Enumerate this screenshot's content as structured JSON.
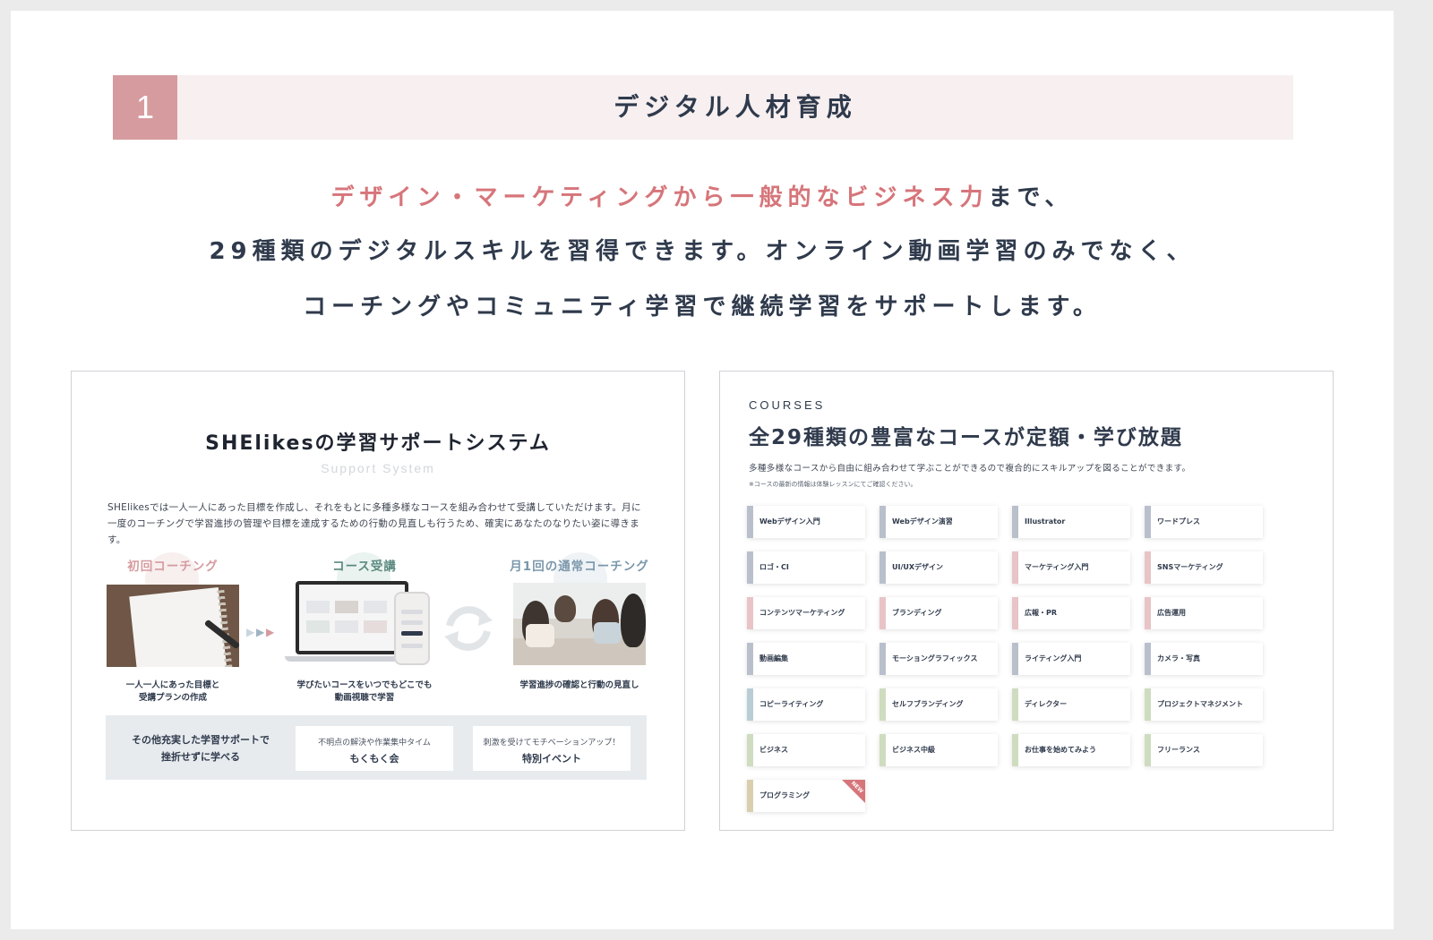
{
  "header": {
    "number": "1",
    "title": "デジタル人材育成"
  },
  "intro": {
    "line1_highlight": "デザイン・マーケティングから一般的なビジネス力",
    "line1_rest": "まで、",
    "line2": "29種類のデジタルスキルを習得できます。オンライン動画学習のみでなく、",
    "line3": "コーチングやコミュニティ学習で継続学習をサポートします。"
  },
  "support": {
    "title": "SHElikesの学習サポートシステム",
    "subtitle": "Support System",
    "description_1": "SHElikesでは一人一人にあった目標を作成し、それをもとに多種多様なコースを組み合わせて受講していただけます。月に",
    "description_2": "一度のコーチングで学習進捗の管理や目標を達成するための行動の見直しも行うため、確実にあなたのなりたい姿に導きます。",
    "steps": [
      {
        "label": "初回コーチング",
        "caption_1": "一人一人にあった目標と",
        "caption_2": "受講プランの作成",
        "color": "#d69b9f"
      },
      {
        "label": "コース受講",
        "caption_1": "学びたいコースをいつでもどこでも",
        "caption_2": "動画視聴で学習",
        "color": "#5a8a7e"
      },
      {
        "label": "月1回の通常コーチング",
        "caption_1": "学習進捗の確認と行動の見直し",
        "caption_2": "",
        "color": "#7a97ab"
      }
    ],
    "bottom": {
      "text_1": "その他充実した学習サポートで",
      "text_2": "挫折せずに学べる",
      "cards": [
        {
          "sub": "不明点の解決や作業集中タイム",
          "title": "もくもく会"
        },
        {
          "sub": "刺激を受けてモチベーションアップ！",
          "title": "特別イベント"
        }
      ]
    }
  },
  "courses": {
    "eyebrow": "COURSES",
    "title": "全29種類の豊富なコースが定額・学び放題",
    "description": "多種多様なコースから自由に組み合わせて学ぶことができるので複合的にスキルアップを図ることができます。",
    "note": "※コースの最新の情報は体験レッスンにてご確認ください。",
    "new_badge": "NEW",
    "items": [
      {
        "label": "Webデザイン入門",
        "color": "#b9c0cc"
      },
      {
        "label": "Webデザイン演習",
        "color": "#b9c0cc"
      },
      {
        "label": "Illustrator",
        "color": "#b9c0cc"
      },
      {
        "label": "ワードプレス",
        "color": "#b9c0cc"
      },
      {
        "label": "ロゴ・CI",
        "color": "#b9c0cc"
      },
      {
        "label": "UI/UXデザイン",
        "color": "#b9c0cc"
      },
      {
        "label": "マーケティング入門",
        "color": "#e8c4c6"
      },
      {
        "label": "SNSマーケティング",
        "color": "#e8c4c6"
      },
      {
        "label": "コンテンツマーケティング",
        "color": "#e8c4c6"
      },
      {
        "label": "ブランディング",
        "color": "#e8c4c6"
      },
      {
        "label": "広報・PR",
        "color": "#e8c4c6"
      },
      {
        "label": "広告運用",
        "color": "#e8c4c6"
      },
      {
        "label": "動画編集",
        "color": "#b9c0cc"
      },
      {
        "label": "モーショングラフィックス",
        "color": "#b9c0cc"
      },
      {
        "label": "ライティング入門",
        "color": "#b9c0cc"
      },
      {
        "label": "カメラ・写真",
        "color": "#b9c0cc"
      },
      {
        "label": "コピーライティング",
        "color": "#b9cdd4"
      },
      {
        "label": "セルフブランディング",
        "color": "#cfdcc0"
      },
      {
        "label": "ディレクター",
        "color": "#cfdcc0"
      },
      {
        "label": "プロジェクトマネジメント",
        "color": "#cfdcc0"
      },
      {
        "label": "ビジネス",
        "color": "#cfdcc0"
      },
      {
        "label": "ビジネス中級",
        "color": "#cfdcc0"
      },
      {
        "label": "お仕事を始めてみよう",
        "color": "#cfdcc0"
      },
      {
        "label": "フリーランス",
        "color": "#cfdcc0"
      },
      {
        "label": "プログラミング",
        "color": "#d9cfae",
        "is_new": true
      }
    ]
  },
  "colors": {
    "accent": "#d69b9f",
    "highlight": "#d6757a",
    "text": "#2f3a4c"
  }
}
